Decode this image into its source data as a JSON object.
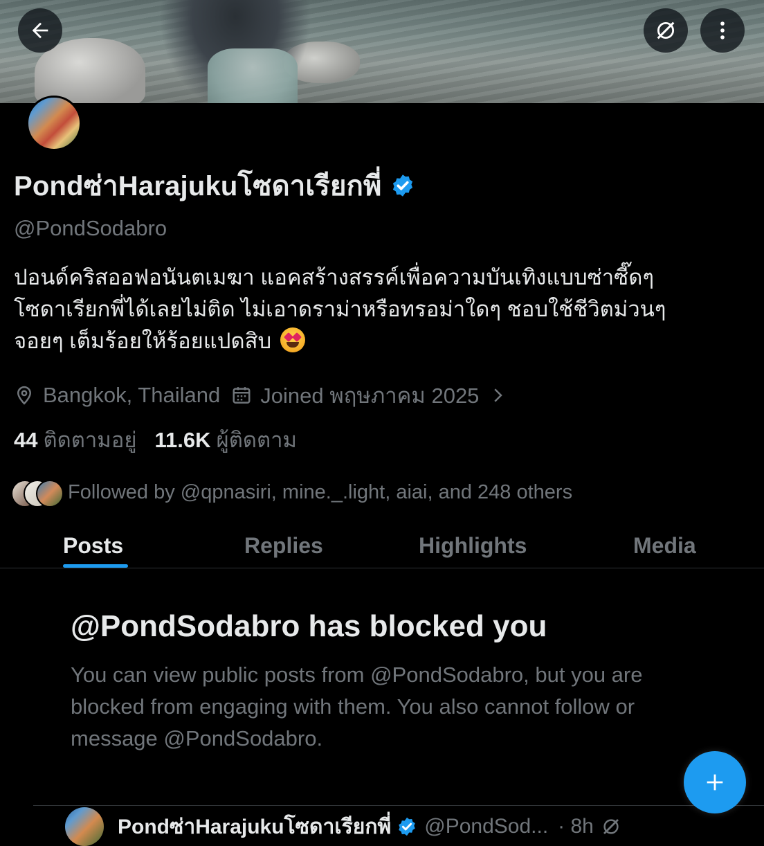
{
  "header": {
    "back_icon": "arrow-left-icon",
    "grok_icon": "grok-icon",
    "more_icon": "more-vertical-icon"
  },
  "profile": {
    "display_name": "Pondซ่าHarajukuโซดาเรียกพี่",
    "handle": "@PondSodabro",
    "verified": true,
    "bio_lines": [
      "ปอนด์คริสออฟอนันตเมฆา แอคสร้างสรรค์เพื่อความบันเทิงแบบซ่าซี๊ดๆ",
      "โซดาเรียกพี่ได้เลยไม่ติด ไม่เอาดราม่าหรือทรอม่าใดๆ ชอบใช้ชีวิตม่วนๆ",
      "จอยๆ เต็มร้อยให้ร้อยแปดสิบ"
    ],
    "bio_emoji": "star-struck-emoji",
    "location": "Bangkok, Thailand",
    "joined": "Joined พฤษภาคม 2025",
    "following_count": "44",
    "following_label": "ติดตามอยู่",
    "followers_count": "11.6K",
    "followers_label": "ผู้ติดตาม",
    "followed_by": "Followed by @qpnasiri, mine._.light, aiai, and 248 others"
  },
  "tabs": [
    {
      "label": "Posts",
      "active": true
    },
    {
      "label": "Replies",
      "active": false
    },
    {
      "label": "Highlights",
      "active": false
    },
    {
      "label": "Media",
      "active": false
    }
  ],
  "blocked": {
    "title": "@PondSodabro has blocked you",
    "body": "You can view public posts from @PondSodabro, but you are blocked from engaging with them. You also cannot follow or message @PondSodabro."
  },
  "post_preview": {
    "name": "Pondซ่าHarajukuโซดาเรียกพี่",
    "handle": "@PondSod...",
    "time": "· 8h"
  },
  "colors": {
    "accent": "#1d9bf0",
    "background": "#000000",
    "text_primary": "#e7e9ea",
    "text_secondary": "#71767b"
  }
}
